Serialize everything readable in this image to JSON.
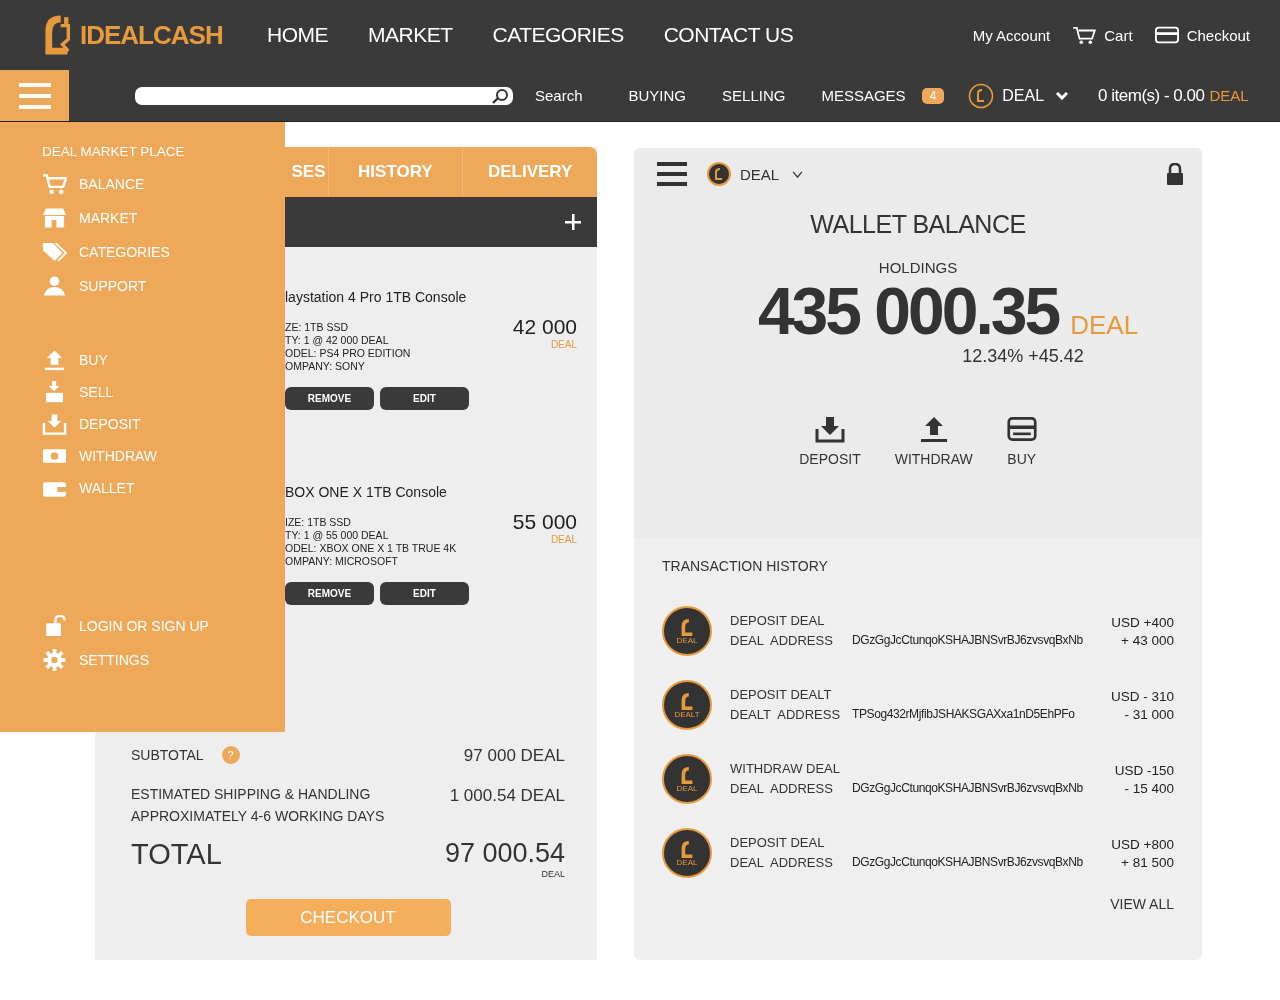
{
  "header": {
    "logo_text": "IDEALCASH",
    "nav": [
      "HOME",
      "MARKET",
      "CATEGORIES",
      "CONTACT US"
    ],
    "account_links": [
      {
        "label": "My Account",
        "kind": "account"
      },
      {
        "label": "Cart",
        "kind": "cart"
      },
      {
        "label": "Checkout",
        "kind": "checkout"
      }
    ]
  },
  "subbar": {
    "search_button": "Search",
    "links": [
      "BUYING",
      "SELLING",
      "MESSAGES"
    ],
    "messages_badge": "4",
    "currency": "DEAL",
    "cart_summary": "0 item(s) - 0.00",
    "cart_unit": "DEAL"
  },
  "side_menu": {
    "title": "DEAL MARKET PLACE",
    "groups": [
      [
        {
          "label": "BALANCE",
          "kind": "cart"
        },
        {
          "label": "MARKET",
          "kind": "store"
        },
        {
          "label": "CATEGORIES",
          "kind": "tags"
        },
        {
          "label": "SUPPORT",
          "kind": "user"
        }
      ],
      [
        {
          "label": "BUY",
          "kind": "upload"
        },
        {
          "label": "SELL",
          "kind": "sell"
        },
        {
          "label": "DEPOSIT",
          "kind": "download"
        },
        {
          "label": "WITHDRAW",
          "kind": "cash"
        },
        {
          "label": "WALLET",
          "kind": "wallet"
        }
      ],
      [
        {
          "label": "LOGIN OR SIGN UP",
          "kind": "lock"
        },
        {
          "label": "SETTINGS",
          "kind": "gear"
        }
      ]
    ]
  },
  "cart": {
    "tabs": [
      {
        "label": "SES",
        "selected": false
      },
      {
        "label": "HISTORY",
        "selected": false
      },
      {
        "label": "DELIVERY",
        "selected": false
      }
    ],
    "items": [
      {
        "title": "laystation 4 Pro 1TB Console",
        "details": [
          "ZE: 1TB SSD",
          "TY: 1 @ 42 000 DEAL",
          "ODEL: PS4 PRO EDITION",
          "OMPANY: SONY"
        ],
        "price": "42 000",
        "unit": "DEAL",
        "buttons": [
          "REMOVE",
          "EDIT"
        ]
      },
      {
        "title": "BOX ONE X  1TB Console",
        "details": [
          "IZE: 1TB SSD",
          "TY: 1 @ 55 000 DEAL",
          "ODEL: XBOX ONE X 1 TB TRUE 4K",
          "OMPANY: MICROSOFT"
        ],
        "price": "55 000",
        "unit": "DEAL",
        "buttons": [
          "REMOVE",
          "EDIT"
        ]
      }
    ],
    "summary": {
      "subtotal_label": "SUBTOTAL",
      "help": "?",
      "subtotal_value": "97 000 DEAL",
      "shipping_label": "ESTIMATED SHIPPING & HANDLING",
      "shipping_note": "APPROXIMATELY 4-6 WORKING DAYS",
      "shipping_value": "1 000.54 DEAL",
      "total_label": "TOTAL",
      "total_value": "97 000.54",
      "total_unit": "DEAL",
      "checkout": "CHECKOUT"
    }
  },
  "wallet": {
    "currency": "DEAL",
    "title": "WALLET BALANCE",
    "holdings_label": "HOLDINGS",
    "amount": "435 000.35",
    "unit": "DEAL",
    "change": "12.34% +45.42",
    "actions": [
      {
        "label": "DEPOSIT",
        "kind": "deposit"
      },
      {
        "label": "WITHDRAW",
        "kind": "withdraw"
      },
      {
        "label": "BUY",
        "kind": "buy"
      }
    ],
    "history_title": "TRANSACTION HISTORY",
    "transactions": [
      {
        "type": "DEPOSIT DEAL",
        "address_label": "DEAL  ADDRESS",
        "address": "DGzGgJcCtunqoKSHAJBNSvrBJ6zvsvqBxNb",
        "usd": "USD +400",
        "amount": "+ 43 000",
        "coin_label": "DEAL"
      },
      {
        "type": "DEPOSIT DEALT",
        "address_label": "DEALT  ADDRESS",
        "address": "TPSog432rMjfibJSHAKSGAXxa1nD5EhPFo",
        "usd": "USD - 310",
        "amount": "- 31 000",
        "coin_label": "DEALT"
      },
      {
        "type": "WITHDRAW DEAL",
        "address_label": "DEAL  ADDRESS",
        "address": "DGzGgJcCtunqoKSHAJBNSvrBJ6zvsvqBxNb",
        "usd": "USD -150",
        "amount": "- 15 400",
        "coin_label": "DEAL"
      },
      {
        "type": "DEPOSIT DEAL",
        "address_label": "DEAL  ADDRESS",
        "address": "DGzGgJcCtunqoKSHAJBNSvrBJ6zvsvqBxNb",
        "usd": "USD +800",
        "amount": "+ 81 500",
        "coin_label": "DEAL"
      }
    ],
    "view_all": "VIEW ALL"
  }
}
